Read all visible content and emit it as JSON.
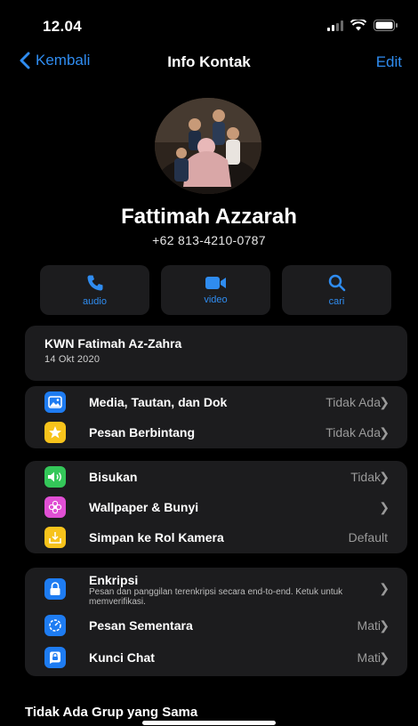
{
  "status": {
    "time": "12.04"
  },
  "nav": {
    "back_label": "Kembali",
    "title": "Info Kontak",
    "edit_label": "Edit"
  },
  "contact": {
    "name": "Fattimah Azzarah",
    "phone": "+62 813-4210-0787"
  },
  "actions": [
    {
      "label": "audio",
      "icon": "phone-icon"
    },
    {
      "label": "video",
      "icon": "video-camera-icon"
    },
    {
      "label": "cari",
      "icon": "search-icon"
    }
  ],
  "group": {
    "title": "KWN Fatimah Az-Zahra",
    "date": "14 Okt 2020"
  },
  "section1": [
    {
      "label": "Media, Tautan, dan Dok",
      "value": "Tidak Ada",
      "icon": "photo-icon",
      "color": "#1e7cf2"
    },
    {
      "label": "Pesan Berbintang",
      "value": "Tidak Ada",
      "icon": "star-icon",
      "color": "#f7c31b"
    }
  ],
  "section2": [
    {
      "label": "Bisukan",
      "value": "Tidak",
      "icon": "speaker-icon",
      "color": "#34c759"
    },
    {
      "label": "Wallpaper & Bunyi",
      "value": "",
      "icon": "flower-icon",
      "color": "#e04fd4"
    },
    {
      "label": "Simpan ke Rol Kamera",
      "value": "Default",
      "icon": "download-icon",
      "color": "#f7c31b"
    }
  ],
  "section3": {
    "encryption": {
      "title": "Enkripsi",
      "desc": "Pesan dan panggilan terenkripsi secara end-to-end. Ketuk untuk memverifikasi.",
      "icon": "lock-icon",
      "color": "#1e7cf2"
    },
    "rows": [
      {
        "label": "Pesan Sementara",
        "value": "Mati",
        "icon": "timer-icon",
        "color": "#1e7cf2"
      },
      {
        "label": "Kunci Chat",
        "value": "Mati",
        "icon": "chat-lock-icon",
        "color": "#1e7cf2"
      }
    ]
  },
  "footer": {
    "title": "Tidak Ada Grup yang Sama"
  }
}
